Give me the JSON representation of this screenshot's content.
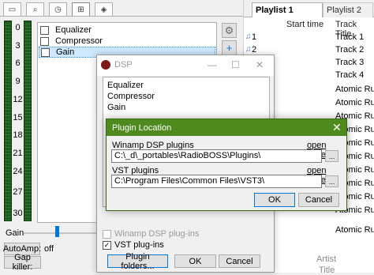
{
  "dsp_panel": {
    "toolbar_icons": [
      "window-icon",
      "search-icon",
      "clock-icon",
      "broadcast-icon",
      "pin-icon"
    ],
    "meter_scale": [
      "0",
      "3",
      "6",
      "9",
      "12",
      "15",
      "18",
      "21",
      "24",
      "27",
      "30"
    ],
    "plugins": [
      {
        "label": "Equalizer",
        "checked": false,
        "selected": false
      },
      {
        "label": "Compressor",
        "checked": false,
        "selected": false
      },
      {
        "label": "Gain",
        "checked": false,
        "selected": true
      }
    ],
    "gain_label": "Gain",
    "autoamp_label": "AutoAmp:",
    "autoamp_value": "off",
    "gapkiller_label": "Gap killer:"
  },
  "playlist_panel": {
    "tabs": [
      {
        "label": "Playlist 1",
        "active": true
      },
      {
        "label": "Playlist 2",
        "active": false
      }
    ],
    "columns": {
      "start_time": "Start time",
      "track_title": "Track Title"
    },
    "rows": [
      {
        "num": "1",
        "title": "Track 1"
      },
      {
        "num": "2",
        "title": "Track 2"
      },
      {
        "num": "",
        "title": "Track 3"
      },
      {
        "num": "",
        "title": "Track 4"
      },
      {
        "num": "",
        "title": "Atomic Rust"
      },
      {
        "num": "",
        "title": "Atomic Rust"
      },
      {
        "num": "",
        "title": "Atomic Rust"
      },
      {
        "num": "",
        "title": "Atomic Rust"
      },
      {
        "num": "",
        "title": "Atomic Rust"
      },
      {
        "num": "",
        "title": "Atomic Rust"
      },
      {
        "num": "",
        "title": "Atomic Rust"
      },
      {
        "num": "",
        "title": "Atomic Rust"
      },
      {
        "num": "",
        "title": "Atomic Rust"
      },
      {
        "num": "",
        "title": "Atomic Rust"
      },
      {
        "num": "",
        "title": "Atomic Rust"
      }
    ],
    "footer_artist": "Artist",
    "footer_title": "Title"
  },
  "dsp_dialog": {
    "title": "DSP",
    "plugins": [
      "Equalizer",
      "Compressor",
      "Gain"
    ],
    "winamp_checkbox": "Winamp DSP plug-ins",
    "vst_checkbox": "VST plug-ins",
    "plugin_folders_button": "Plugin folders...",
    "ok_button": "OK",
    "cancel_button": "Cancel"
  },
  "plugin_location_dialog": {
    "title": "Plugin Location",
    "winamp_label": "Winamp DSP plugins",
    "winamp_open": "open folder",
    "winamp_path": "C:\\_d\\_portables\\RadioBOSS\\Plugins\\",
    "vst_label": "VST plugins",
    "vst_open": "open folder",
    "vst_path": "C:\\Program Files\\Common Files\\VST3\\",
    "browse": "...",
    "ok_button": "OK",
    "cancel_button": "Cancel"
  },
  "colors": {
    "titlebar_green": "#4f8a1e",
    "meter_green": "#1f5b1f",
    "selection_blue": "#cde8ff",
    "slider_blue": "#0078d7"
  }
}
